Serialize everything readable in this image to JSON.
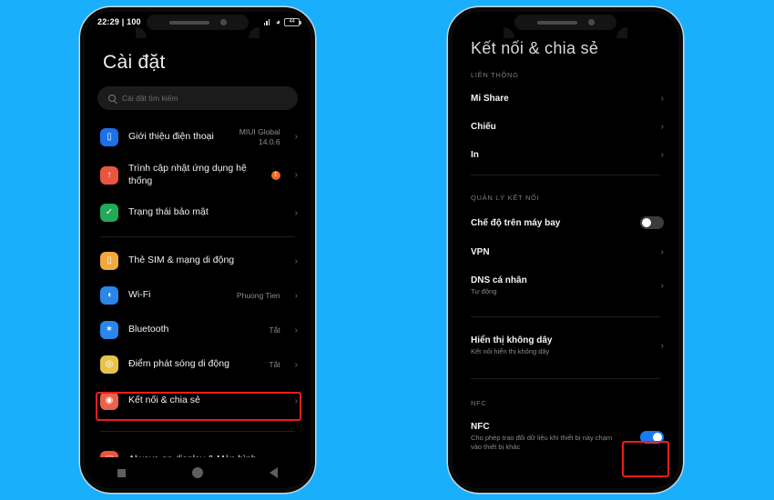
{
  "background_color": "#1aaffc",
  "highlight_color": "#ef1c1c",
  "left_phone": {
    "status_bar": {
      "time": "22:29 | 100",
      "signal_icon": "cellular-signal-icon",
      "wifi_icon": "wifi-icon",
      "battery_level": "44"
    },
    "title": "Cài đặt",
    "search": {
      "placeholder": "Cài đặt tìm kiếm",
      "icon": "search-icon"
    },
    "groups": [
      {
        "items": [
          {
            "label": "Giới thiệu điện thoại",
            "value": "MIUI Global\n14.0.6",
            "icon": "phone-info-icon",
            "icon_color": "#1b72e8",
            "glyph": "▯",
            "chevron": true,
            "badge": null
          },
          {
            "label": "Trình cập nhật ứng dụng hệ thống",
            "value": "",
            "icon": "system-updater-icon",
            "icon_color": "#e8563f",
            "glyph": "↑",
            "chevron": true,
            "badge": "1"
          },
          {
            "label": "Trạng thái bảo mật",
            "value": "",
            "icon": "security-status-icon",
            "icon_color": "#22a95a",
            "glyph": "✓",
            "chevron": true,
            "badge": null
          }
        ]
      },
      {
        "items": [
          {
            "label": "Thẻ SIM & mạng di động",
            "value": "",
            "icon": "sim-card-icon",
            "icon_color": "#f0a93c",
            "glyph": "▯",
            "chevron": true,
            "badge": null
          },
          {
            "label": "Wi-Fi",
            "value": "Phuong Tien",
            "icon": "wifi-settings-icon",
            "icon_color": "#2a86e8",
            "glyph": "≋",
            "chevron": true,
            "badge": null
          },
          {
            "label": "Bluetooth",
            "value": "Tắt",
            "icon": "bluetooth-icon",
            "icon_color": "#2a86e8",
            "glyph": "✶",
            "chevron": true,
            "badge": null
          },
          {
            "label": "Điểm phát sóng di động",
            "value": "Tắt",
            "icon": "mobile-hotspot-icon",
            "icon_color": "#e8c24a",
            "glyph": "◎",
            "chevron": true,
            "badge": null
          },
          {
            "label": "Kết nối & chia sẻ",
            "value": "",
            "icon": "connection-sharing-icon",
            "icon_color": "#e8634a",
            "glyph": "◉",
            "chevron": true,
            "badge": null,
            "highlighted": true
          }
        ]
      },
      {
        "items": [
          {
            "label": "Always-on display & Màn hình",
            "value": "",
            "icon": "always-on-display-icon",
            "icon_color": "#e8563f",
            "glyph": "▤",
            "chevron": false,
            "badge": null
          }
        ]
      }
    ],
    "nav_bar": {
      "recents": "recents-square-icon",
      "home": "home-circle-icon",
      "back": "back-triangle-icon"
    }
  },
  "right_phone": {
    "title": "Kết nối & chia sẻ",
    "sections": [
      {
        "header": "LIÊN THÔNG",
        "items": [
          {
            "title": "Mi Share",
            "subtitle": "",
            "control": "chevron"
          },
          {
            "title": "Chiếu",
            "subtitle": "",
            "control": "chevron"
          },
          {
            "title": "In",
            "subtitle": "",
            "control": "chevron"
          }
        ]
      },
      {
        "header": "QUẢN LÝ KẾT NỐI",
        "items": [
          {
            "title": "Chế độ trên máy bay",
            "subtitle": "",
            "control": "toggle",
            "toggle_on": false
          },
          {
            "title": "VPN",
            "subtitle": "",
            "control": "chevron"
          },
          {
            "title": "DNS cá nhân",
            "subtitle": "Tự động",
            "control": "chevron"
          }
        ]
      },
      {
        "header": "",
        "items": [
          {
            "title": "Hiển thị không dây",
            "subtitle": "Kết nối hiển thị không dây",
            "control": "chevron"
          }
        ]
      },
      {
        "header": "NFC",
        "items": [
          {
            "title": "NFC",
            "subtitle": "Cho phép trao đổi dữ liệu khi thiết bị này chạm vào thiết bị khác",
            "control": "toggle",
            "toggle_on": true,
            "highlighted": true
          }
        ]
      }
    ]
  }
}
